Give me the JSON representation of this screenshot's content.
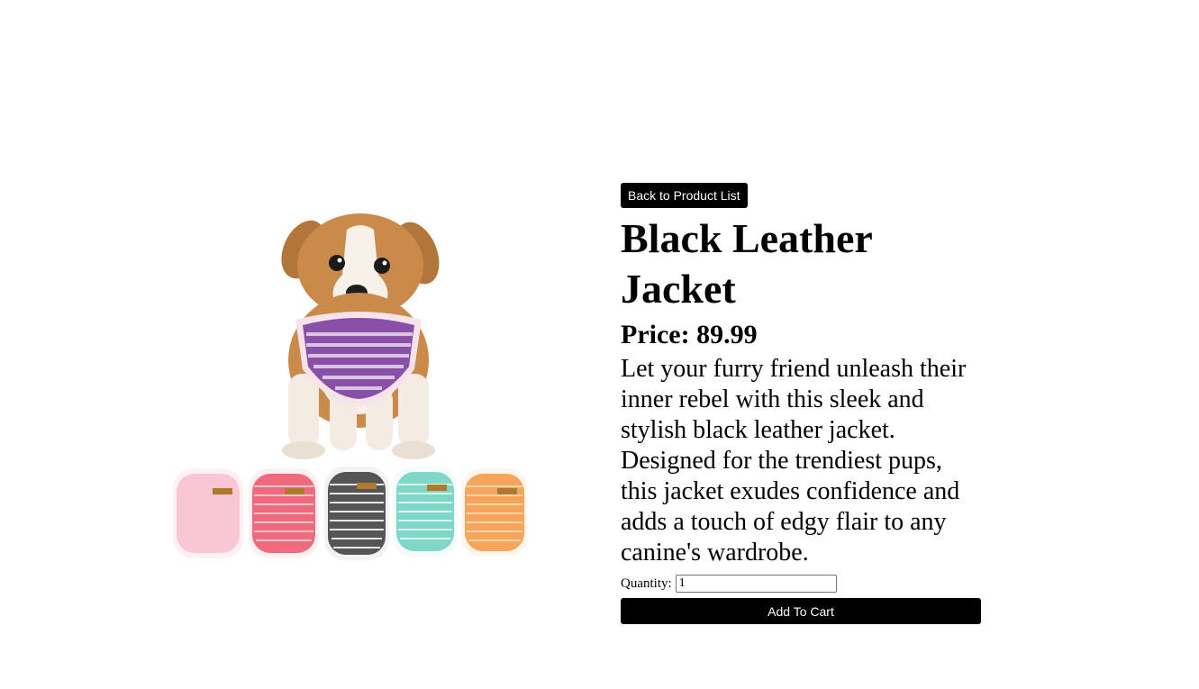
{
  "product": {
    "back_label": "Back to Product List",
    "title": "Black Leather Jacket",
    "price_label": "Price:",
    "price": "89.99",
    "description": "Let your furry friend unleash their inner rebel with this sleek and stylish black leather jacket. Designed for the trendiest pups, this jacket exudes confidence and adds a touch of edgy flair to any canine's wardrobe.",
    "quantity_label": "Quantity:",
    "quantity_value": "1",
    "add_to_cart_label": "Add To Cart"
  },
  "image": {
    "icon": "product-photo",
    "shirt_colors": [
      "#f9c6d6",
      "#ee6a7c",
      "#555555",
      "#7fd8c7",
      "#f6a55a"
    ],
    "main_shirt_color": "#8a4fa6",
    "dog_color": "#c98a4a"
  }
}
